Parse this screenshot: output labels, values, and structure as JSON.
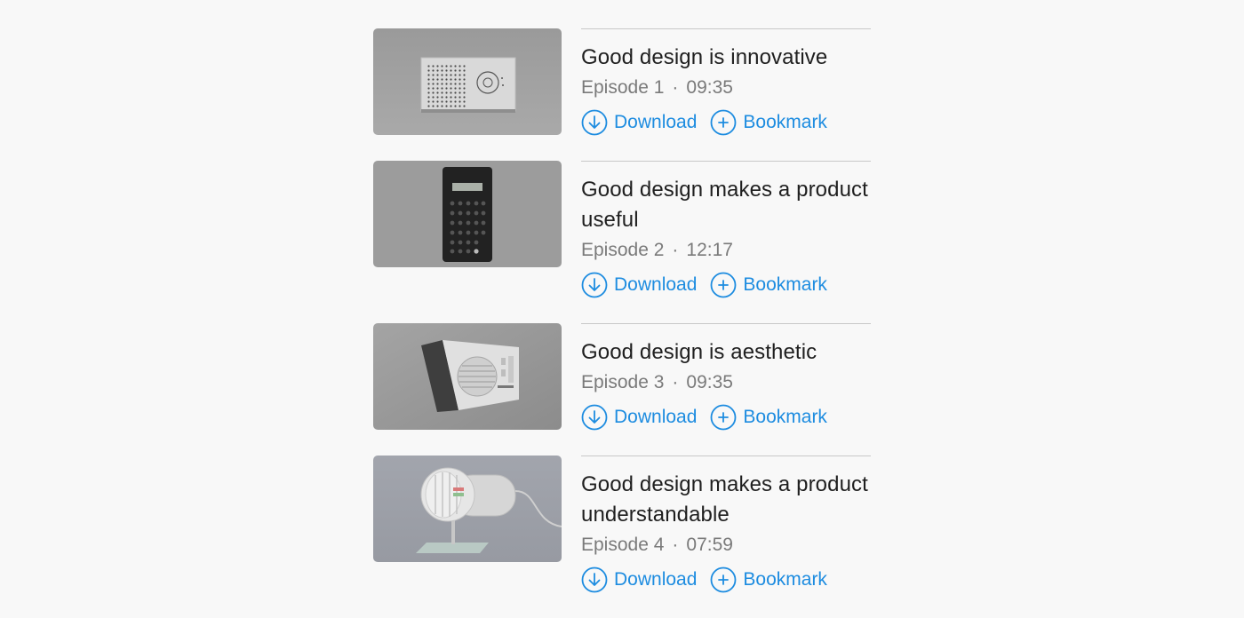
{
  "episodes": [
    {
      "title": "Good design is innovative",
      "episode": "Episode 1",
      "separator": "·",
      "duration": "09:35",
      "download_label": "Download",
      "bookmark_label": "Bookmark",
      "thumbnail": "radio-speaker-product"
    },
    {
      "title": "Good design makes a product useful",
      "episode": "Episode 2",
      "separator": "·",
      "duration": "12:17",
      "download_label": "Download",
      "bookmark_label": "Bookmark",
      "thumbnail": "calculator-product"
    },
    {
      "title": "Good design is aesthetic",
      "episode": "Episode 3",
      "separator": "·",
      "duration": "09:35",
      "download_label": "Download",
      "bookmark_label": "Bookmark",
      "thumbnail": "table-radio-product"
    },
    {
      "title": "Good design makes a product understandable",
      "episode": "Episode 4",
      "separator": "·",
      "duration": "07:59",
      "download_label": "Download",
      "bookmark_label": "Bookmark",
      "thumbnail": "fan-heater-product"
    }
  ],
  "colors": {
    "accent": "#1d8ce0",
    "title_text": "#1f1f1f",
    "meta_text": "#7a7a7a",
    "divider": "#c8c8c8",
    "background": "#f8f8f8"
  }
}
